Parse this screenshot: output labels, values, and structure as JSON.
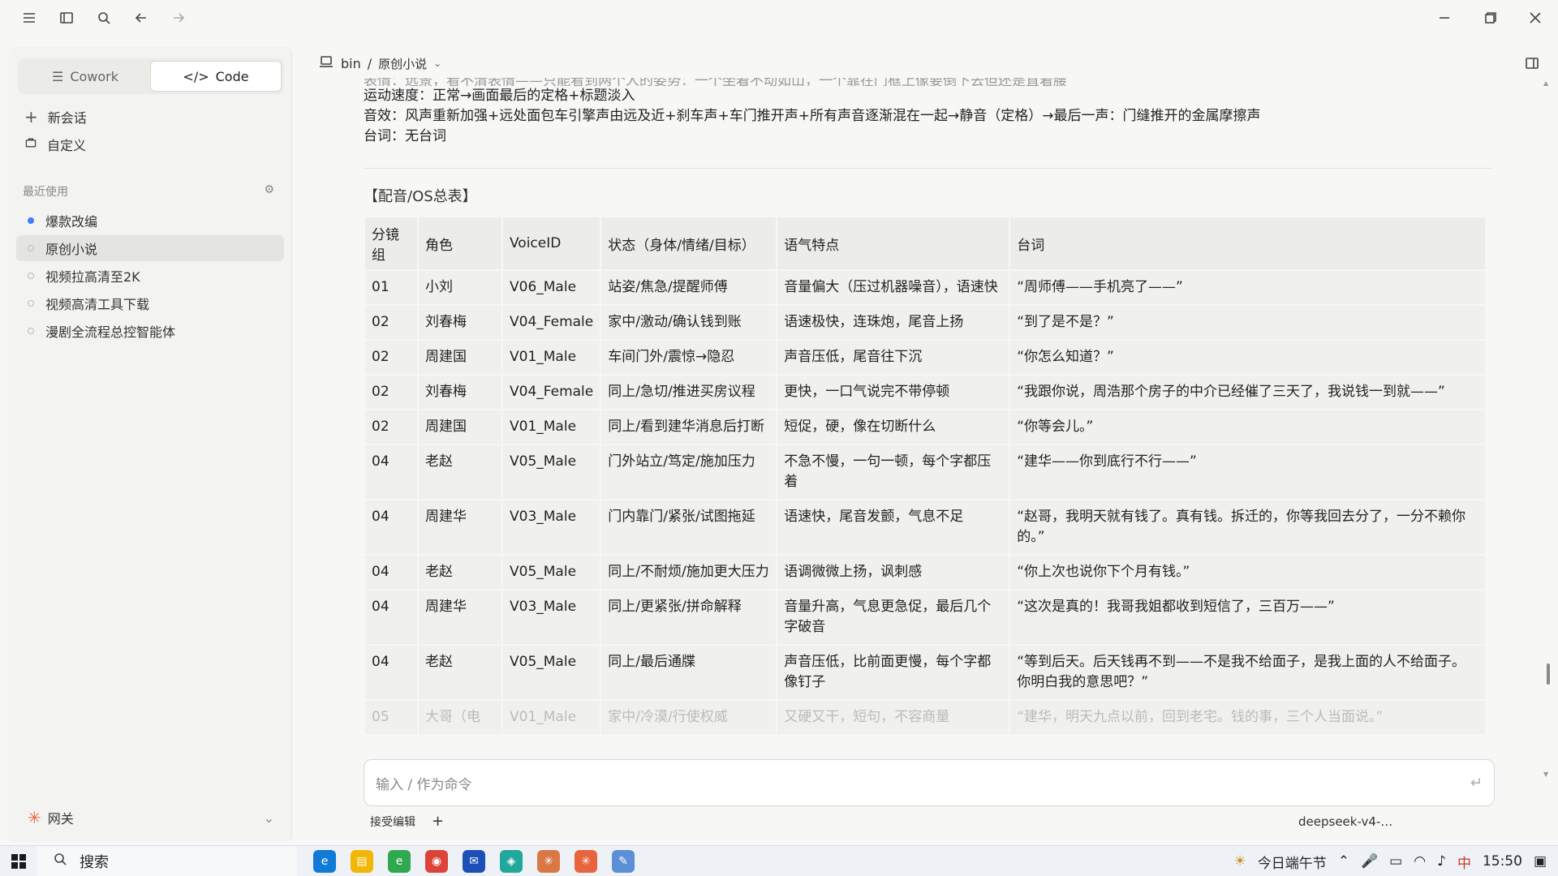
{
  "titlebar": {
    "icons": [
      "menu-icon",
      "sidebar-icon",
      "search-icon",
      "back-icon",
      "forward-icon"
    ],
    "window_controls": [
      "minimize-icon",
      "restore-icon",
      "close-icon"
    ]
  },
  "sidebar": {
    "modes": [
      {
        "label": "Cowork",
        "icon": "cowork-icon",
        "active": false
      },
      {
        "label": "Code",
        "icon": "code-icon",
        "active": true
      }
    ],
    "new_chat": "新会话",
    "customize": "自定义",
    "recent_title": "最近使用",
    "recent": [
      {
        "label": "爆款改编",
        "status": "active-dot"
      },
      {
        "label": "原创小说",
        "status": "selected"
      },
      {
        "label": "视频拉高清至2K",
        "status": ""
      },
      {
        "label": "视频高清工具下载",
        "status": ""
      },
      {
        "label": "漫剧全流程总控智能体",
        "status": ""
      }
    ],
    "footer_label": "网关"
  },
  "main": {
    "breadcrumb": {
      "root": "bin",
      "sep": "/",
      "current": "原创小说"
    },
    "paragraphs": {
      "cut_line": "表情：远景，看不清表情——只能看到两个人的姿势：一个坐着不动如山，一个靠在门框上像要倒下去但还是直着腰",
      "speed": "运动速度：正常→画面最后的定格+标题淡入",
      "sfx": "音效：风声重新加强+远处面包车引擎声由远及近+刹车声+车门推开声+所有声音逐渐混在一起→静音（定格）→最后一声：门缝推开的金属摩擦声",
      "lines": "台词：无台词"
    },
    "section_title": "【配音/OS总表】",
    "table": {
      "headers": [
        "分镜组",
        "角色",
        "VoiceID",
        "状态（身体/情绪/目标）",
        "语气特点",
        "台词"
      ],
      "rows": [
        [
          "01",
          "小刘",
          "V06_Male",
          "站姿/焦急/提醒师傅",
          "音量偏大（压过机器噪音），语速快",
          "“周师傅——手机亮了——”"
        ],
        [
          "02",
          "刘春梅",
          "V04_Female",
          "家中/激动/确认钱到账",
          "语速极快，连珠炮，尾音上扬",
          "“到了是不是？”"
        ],
        [
          "02",
          "周建国",
          "V01_Male",
          "车间门外/震惊→隐忍",
          "声音压低，尾音往下沉",
          "“你怎么知道？”"
        ],
        [
          "02",
          "刘春梅",
          "V04_Female",
          "同上/急切/推进买房议程",
          "更快，一口气说完不带停顿",
          "“我跟你说，周浩那个房子的中介已经催了三天了，我说钱一到就——”"
        ],
        [
          "02",
          "周建国",
          "V01_Male",
          "同上/看到建华消息后打断",
          "短促，硬，像在切断什么",
          "“你等会儿。”"
        ],
        [
          "04",
          "老赵",
          "V05_Male",
          "门外站立/笃定/施加压力",
          "不急不慢，一句一顿，每个字都压着",
          "“建华——你到底行不行——”"
        ],
        [
          "04",
          "周建华",
          "V03_Male",
          "门内靠门/紧张/试图拖延",
          "语速快，尾音发颤，气息不足",
          "“赵哥，我明天就有钱了。真有钱。拆迁的，你等我回去分了，一分不赖你的。”"
        ],
        [
          "04",
          "老赵",
          "V05_Male",
          "同上/不耐烦/施加更大压力",
          "语调微微上扬，讽刺感",
          "“你上次也说你下个月有钱。”"
        ],
        [
          "04",
          "周建华",
          "V03_Male",
          "同上/更紧张/拼命解释",
          "音量升高，气息更急促，最后几个字破音",
          "“这次是真的！我哥我姐都收到短信了，三百万——”"
        ],
        [
          "04",
          "老赵",
          "V05_Male",
          "同上/最后通牒",
          "声音压低，比前面更慢，每个字都像钉子",
          "“等到后天。后天钱再不到——不是我不给面子，是我上面的人不给面子。你明白我的意思吧？”"
        ],
        [
          "05",
          "大哥（电",
          "V01_Male",
          "家中/冷漠/行使权威",
          "又硬又干，短句，不容商量",
          "“建华，明天九点以前，回到老宅。钱的事，三个人当面说。”"
        ]
      ]
    },
    "composer": {
      "placeholder": "输入 / 作为命令",
      "accept_edits": "接受编辑",
      "plus": "+",
      "model": "deepseek-v4-…"
    }
  },
  "taskbar": {
    "search_label": "搜索",
    "apps": [
      "edge-icon",
      "explorer-icon",
      "browser-icon",
      "chrome-icon",
      "app-icon",
      "app2-icon",
      "claude-icon",
      "claude-active-icon",
      "notepad-icon"
    ],
    "weather_text": "今日端午节",
    "ime": "中",
    "time": "15:50"
  },
  "colors": {
    "accent": "#3b82f6",
    "claude": "#e8643c"
  }
}
